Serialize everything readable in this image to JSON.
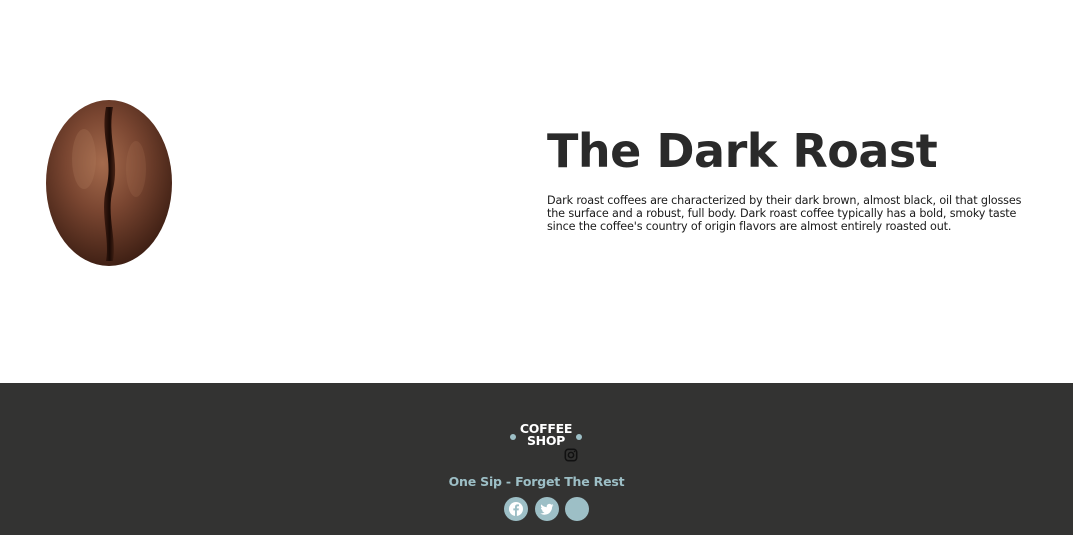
{
  "hero": {
    "title": "The Dark Roast",
    "description_lines": [
      "Dark roast coffees are characterized by their dark brown, almost black, oil that glosses",
      "the surface and a robust, full body. Dark roast coffee typically has a bold, smoky taste",
      "since the coffee's country of origin flavors are almost entirely roasted out."
    ],
    "image": "coffee-bean-icon"
  },
  "footer": {
    "logo_line1": "COFFEE",
    "logo_line2": "SHOP",
    "tagline": "One Sip - Forget The Rest",
    "social_icons": [
      "facebook-icon",
      "twitter-icon",
      "instagram-icon"
    ]
  },
  "colors": {
    "footer_bg": "#333332",
    "accent": "#9dbfc6",
    "title": "#2a2a2a"
  }
}
